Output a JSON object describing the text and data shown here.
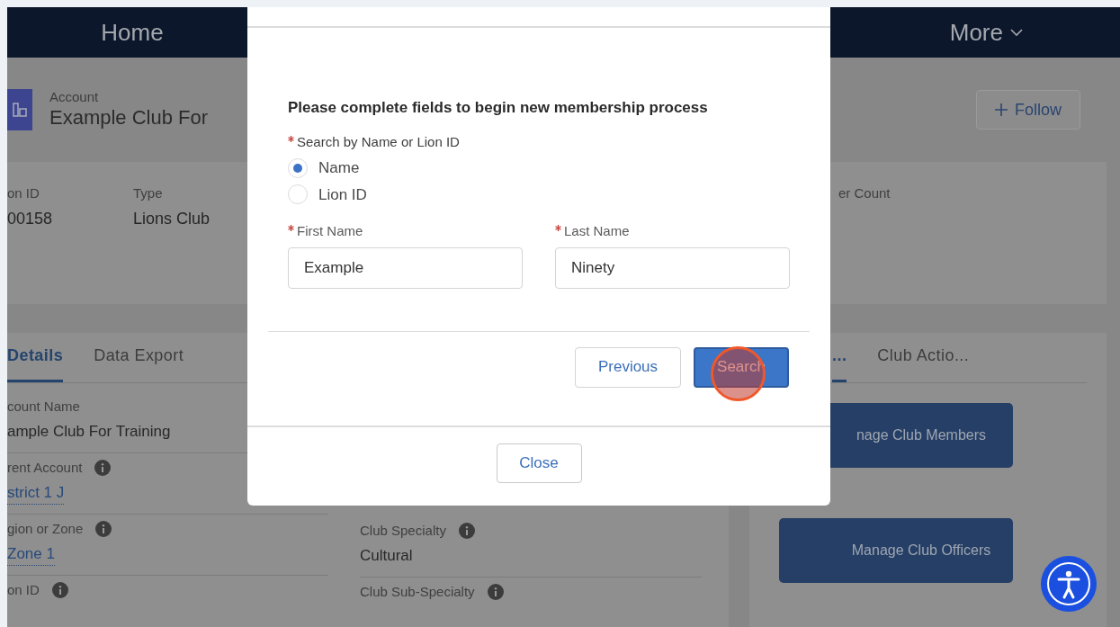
{
  "nav": {
    "items": [
      {
        "label": "Home",
        "kind": "link"
      },
      {
        "label": "More",
        "kind": "menu"
      }
    ]
  },
  "header": {
    "object_type": "Account",
    "title": "Example Club For",
    "follow_button": "Follow"
  },
  "highlights": [
    {
      "label": "on ID",
      "value": "00158"
    },
    {
      "label": "Type",
      "value": "Lions Club"
    },
    {
      "label": "er Count"
    }
  ],
  "details_card": {
    "tabs": [
      {
        "label": "Details",
        "selected": true
      },
      {
        "label": "Data Export",
        "selected": false
      }
    ],
    "columns": [
      [
        {
          "label": "count Name",
          "info": false,
          "value": "ample Club For Training",
          "kind": "text"
        },
        {
          "label": "rent Account",
          "info": true,
          "value": "strict 1 J",
          "kind": "link"
        },
        {
          "label": "gion or Zone",
          "info": true,
          "value": "Zone 1",
          "kind": "link"
        },
        {
          "label": "on ID",
          "info": true
        }
      ],
      [
        {
          "label": "Club Specialty",
          "info": true,
          "value": "Cultural",
          "kind": "text"
        },
        {
          "label": "Club Sub-Specialty",
          "info": true
        }
      ]
    ]
  },
  "actions_card": {
    "tabs": [
      {
        "label": "...",
        "selected": true
      },
      {
        "label": "Club Actio...",
        "selected": false
      }
    ],
    "buttons": [
      "nage Club Members",
      "Manage Club Officers"
    ]
  },
  "modal": {
    "heading": "Please complete fields to begin new membership process",
    "search_by": {
      "label": "Search by Name or Lion ID",
      "required": true,
      "options": [
        {
          "label": "Name",
          "selected": true
        },
        {
          "label": "Lion ID",
          "selected": false
        }
      ]
    },
    "fields": [
      {
        "label": "First Name",
        "required": true,
        "value": "Example"
      },
      {
        "label": "Last Name",
        "required": true,
        "value": "Ninety"
      }
    ],
    "buttons": [
      {
        "label": "Previous",
        "kind": "neutral"
      },
      {
        "label": "Search",
        "kind": "brand"
      }
    ],
    "footer_button": "Close"
  }
}
